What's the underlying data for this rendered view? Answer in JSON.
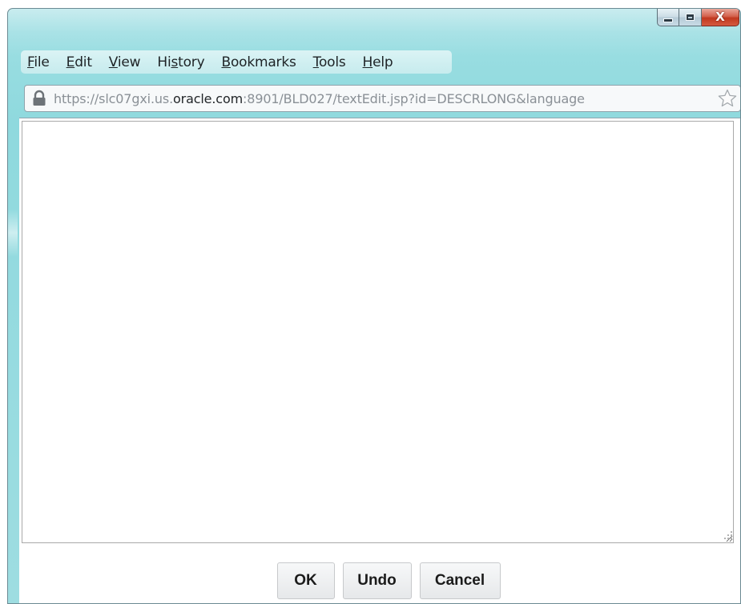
{
  "window": {
    "caption_buttons": {
      "minimize_icon": "minimize-icon",
      "maximize_icon": "maximize-icon",
      "close_icon": "close-icon",
      "close_label": "X"
    }
  },
  "menubar": {
    "items": [
      {
        "pre": "",
        "key": "F",
        "post": "ile"
      },
      {
        "pre": "",
        "key": "E",
        "post": "dit"
      },
      {
        "pre": "",
        "key": "V",
        "post": "iew"
      },
      {
        "pre": "Hi",
        "key": "s",
        "post": "tory"
      },
      {
        "pre": "",
        "key": "B",
        "post": "ookmarks"
      },
      {
        "pre": "",
        "key": "T",
        "post": "ools"
      },
      {
        "pre": "",
        "key": "H",
        "post": "elp"
      }
    ]
  },
  "address": {
    "icon": "lock-icon",
    "url_prefix": "https://slc07gxi.us.",
    "url_domain": "oracle.com",
    "url_suffix": ":8901/BLD027/textEdit.jsp?id=DESCRLONG&language",
    "bookmark_icon": "star-icon"
  },
  "editor": {
    "value": ""
  },
  "buttons": {
    "ok": "OK",
    "undo": "Undo",
    "cancel": "Cancel"
  },
  "colors": {
    "frame": "#9edde1",
    "close_button": "#c1381f",
    "url_domain": "#222629",
    "url_muted": "#8a9096"
  }
}
